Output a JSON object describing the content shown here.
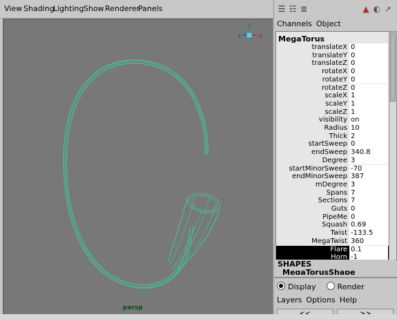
{
  "menubar": {
    "items": [
      "View",
      "Shading",
      "Lighting",
      "Show",
      "Renderer",
      "Panels"
    ]
  },
  "viewport": {
    "camera_label": "persp",
    "background": "#787878",
    "wire_color": "#3ec896",
    "axis_labels": {
      "y": "y",
      "x": "x",
      "z": "z"
    }
  },
  "channel_box": {
    "tabs": [
      "Channels",
      "Object"
    ],
    "node_name": "MegaTorus",
    "attributes": [
      {
        "label": "translateX",
        "value": "0"
      },
      {
        "label": "translateY",
        "value": "0"
      },
      {
        "label": "translateZ",
        "value": "0"
      },
      {
        "label": "rotateX",
        "value": "0"
      },
      {
        "label": "rotateY",
        "value": "0"
      },
      {
        "label": "rotateZ",
        "value": "0"
      },
      {
        "label": "scaleX",
        "value": "1"
      },
      {
        "label": "scaleY",
        "value": "1"
      },
      {
        "label": "scaleZ",
        "value": "1"
      },
      {
        "label": "visibility",
        "value": "on"
      },
      {
        "label": "Radius",
        "value": "10"
      },
      {
        "label": "Thick",
        "value": "2"
      },
      {
        "label": "startSweep",
        "value": "0"
      },
      {
        "label": "endSweep",
        "value": "340.8"
      },
      {
        "label": "Degree",
        "value": "3"
      },
      {
        "label": "startMinorSweep",
        "value": "-70"
      },
      {
        "label": "endMinorSweep",
        "value": "387"
      },
      {
        "label": "mDegree",
        "value": "3"
      },
      {
        "label": "Spans",
        "value": "7"
      },
      {
        "label": "Sections",
        "value": "7"
      },
      {
        "label": "Guts",
        "value": "0"
      },
      {
        "label": "PipeMe",
        "value": "0"
      },
      {
        "label": "Squash",
        "value": "0.69"
      },
      {
        "label": "Twist",
        "value": "-133.5"
      },
      {
        "label": "MegaTwist",
        "value": "360"
      },
      {
        "label": "Flare",
        "value": "0.1",
        "selected": true
      },
      {
        "label": "Horn",
        "value": "-1",
        "selected": true
      }
    ],
    "shapes_title": "SHAPES",
    "shapes_node": "MegaTorusShape"
  },
  "layer_editor": {
    "display_label": "Display",
    "render_label": "Render",
    "selected_mode": "Display",
    "menu": [
      "Layers",
      "Options",
      "Help"
    ],
    "nav_prev": "<<",
    "nav_next": ">>"
  }
}
